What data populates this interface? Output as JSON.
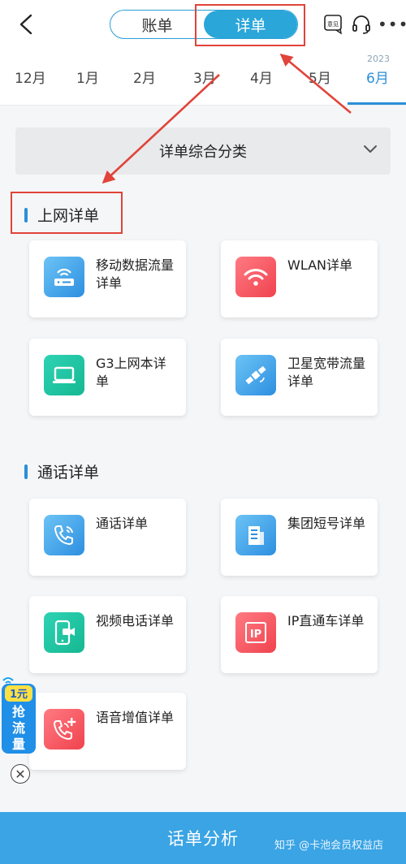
{
  "header": {
    "tabs": [
      "账单",
      "详单"
    ],
    "active_tab": "详单",
    "feedback_label": "意见"
  },
  "months": {
    "year": "2023",
    "items": [
      "12月",
      "1月",
      "2月",
      "3月",
      "4月",
      "5月",
      "6月"
    ],
    "active": "6月"
  },
  "filter": {
    "label": "详单综合分类"
  },
  "sections": [
    {
      "title": "上网详单",
      "cards": [
        {
          "label": "移动数据流量详单",
          "icon": "router-icon",
          "color": "#2d8fe0"
        },
        {
          "label": "WLAN详单",
          "icon": "wifi-icon",
          "color": "#f0434e"
        },
        {
          "label": "G3上网本详单",
          "icon": "laptop-icon",
          "color": "#16b892"
        },
        {
          "label": "卫星宽带流量详单",
          "icon": "satellite-icon",
          "color": "#2d8fe0"
        }
      ]
    },
    {
      "title": "通话详单",
      "cards": [
        {
          "label": "通话详单",
          "icon": "phone-call-icon",
          "color": "#2d8fe0"
        },
        {
          "label": "集团短号详单",
          "icon": "building-icon",
          "color": "#2d8fe0"
        },
        {
          "label": "视频电话详单",
          "icon": "video-call-icon",
          "color": "#16b892"
        },
        {
          "label": "IP直通车详单",
          "icon": "ip-icon",
          "color": "#f0434e"
        },
        {
          "label": "语音增值详单",
          "icon": "phone-plus-icon",
          "color": "#f0434e"
        }
      ]
    }
  ],
  "promo": {
    "line1": "1元",
    "line2": "抢",
    "line3": "流",
    "line4": "量"
  },
  "bottom": {
    "label": "话单分析"
  },
  "watermark": "知乎 @卡池会员权益店",
  "colors": {
    "accent": "#2b8fd8",
    "annotation": "#e0443a",
    "bottom_bar": "#3aa4e4"
  }
}
